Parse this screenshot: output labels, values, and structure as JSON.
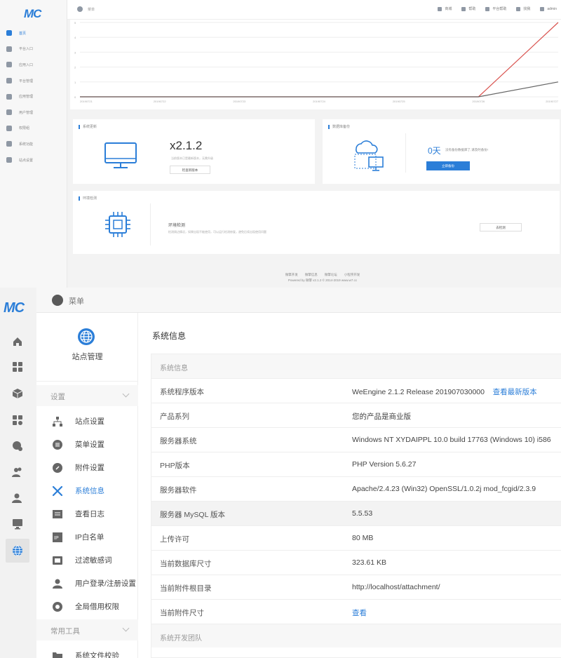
{
  "dashboard": {
    "logo": "MC",
    "sidebar": [
      {
        "label": "首页",
        "icon": "home-icon",
        "active": true
      },
      {
        "label": "平台入口",
        "icon": "grid-icon"
      },
      {
        "label": "应用入口",
        "icon": "box-icon"
      },
      {
        "label": "平台管理",
        "icon": "apps-icon"
      },
      {
        "label": "应用管理",
        "icon": "cubes-icon"
      },
      {
        "label": "用户管理",
        "icon": "users-icon"
      },
      {
        "label": "权限组",
        "icon": "user-key-icon"
      },
      {
        "label": "系统功能",
        "icon": "monitor-icon"
      },
      {
        "label": "站点设置",
        "icon": "globe-icon"
      }
    ],
    "header": {
      "menu_label": "菜单",
      "links": [
        "商城",
        "帮助",
        "平台帮助",
        "找我",
        "admin"
      ]
    },
    "chart_data": {
      "type": "line",
      "x": [
        "20190721",
        "20190722",
        "20190723",
        "20190724",
        "20190725",
        "20190726",
        "20190727"
      ],
      "ylim": [
        0,
        5
      ],
      "series": [
        {
          "color": "#d9534f",
          "values": [
            0,
            0,
            0,
            0,
            0,
            0,
            5
          ]
        },
        {
          "color": "#666666",
          "values": [
            0,
            0,
            0,
            0,
            0,
            0,
            1
          ]
        }
      ]
    },
    "system_card": {
      "title": "系统更新",
      "version": "x2.1.2",
      "note": "当前版本已是最新版本，无需升级",
      "button": "检查新版本"
    },
    "db_card": {
      "title": "数据库备份",
      "days": "0天",
      "note": "没有备份数据库了,请及时备份!",
      "button": "立即备份"
    },
    "env_card": {
      "title": "环境检测",
      "heading": "环境检测",
      "note": "检测周边情况，如果出现不能使用，可以运行检测修复，避免后续出现使用问题",
      "button": "去检测"
    },
    "footer": {
      "links": [
        "微擎开发",
        "微擎信息",
        "微擎论坛",
        "小程序开发"
      ],
      "powered": "Powered by 微擎 v2.1.2 © 2014-2019 www.w7.cc"
    }
  },
  "sysinfo": {
    "logo": "MC",
    "rail_icons": [
      "home-icon",
      "grid-icon",
      "box-icon",
      "apps-icon",
      "cubes-icon",
      "users-icon",
      "user-key-icon",
      "monitor-icon",
      "globe-icon"
    ],
    "topbar": {
      "menu_label": "菜单"
    },
    "submenu": {
      "header": "站点管理",
      "group1": "设置",
      "items": [
        {
          "label": "站点设置",
          "icon": "sitemap-icon"
        },
        {
          "label": "菜单设置",
          "icon": "menu-circle-icon"
        },
        {
          "label": "附件设置",
          "icon": "attachment-icon"
        },
        {
          "label": "系统信息",
          "icon": "tools-icon",
          "active": true
        },
        {
          "label": "查看日志",
          "icon": "log-icon"
        },
        {
          "label": "IP白名单",
          "icon": "ip-icon"
        },
        {
          "label": "过滤敏感词",
          "icon": "filter-icon"
        },
        {
          "label": "用户登录/注册设置",
          "icon": "user-icon"
        },
        {
          "label": "全局借用权限",
          "icon": "permission-icon"
        }
      ],
      "group2": "常用工具",
      "tools": [
        {
          "label": "系统文件校验",
          "icon": "folder-icon"
        }
      ]
    },
    "page_title": "系统信息",
    "panel_header": "系统信息",
    "rows": [
      {
        "key": "系统程序版本",
        "value": "WeEngine 2.1.2 Release 201907030000",
        "link": "查看最新版本"
      },
      {
        "key": "产品系列",
        "value": "您的产品是商业版"
      },
      {
        "key": "服务器系统",
        "value": "Windows NT XYDAIPPL 10.0 build 17763 (Windows 10) i586"
      },
      {
        "key": "PHP版本",
        "value": "PHP Version 5.6.27"
      },
      {
        "key": "服务器软件",
        "value": "Apache/2.4.23 (Win32) OpenSSL/1.0.2j mod_fcgid/2.3.9"
      },
      {
        "key": "服务器 MySQL 版本",
        "value": "5.5.53",
        "highlight": true
      },
      {
        "key": "上传许可",
        "value": "80 MB"
      },
      {
        "key": "当前数据库尺寸",
        "value": "323.61 KB"
      },
      {
        "key": "当前附件根目录",
        "value": "http://localhost/attachment/"
      },
      {
        "key": "当前附件尺寸",
        "value": "",
        "link": "查看"
      }
    ],
    "team_header": "系统开发团队"
  }
}
